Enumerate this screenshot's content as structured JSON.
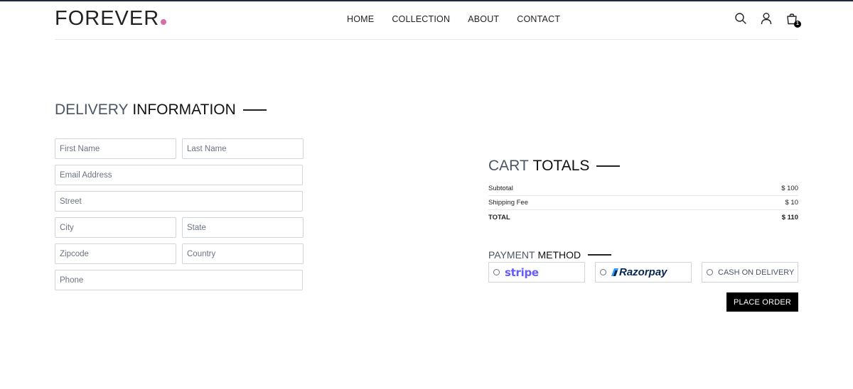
{
  "brand": {
    "name": "FOREVER",
    "dot_color": "#d66ca8"
  },
  "nav": {
    "items": [
      "HOME",
      "COLLECTION",
      "ABOUT",
      "CONTACT"
    ]
  },
  "header_icons": {
    "search": "search-icon",
    "profile": "user-icon",
    "cart": "shopping-bag-icon",
    "cart_count": "1"
  },
  "delivery": {
    "title_light": "DELIVERY",
    "title_dark": "INFORMATION",
    "fields": {
      "first_name": "First Name",
      "last_name": "Last Name",
      "email": "Email Address",
      "street": "Street",
      "city": "City",
      "state": "State",
      "zipcode": "Zipcode",
      "country": "Country",
      "phone": "Phone"
    }
  },
  "cart": {
    "title_light": "CART",
    "title_dark": "TOTALS",
    "rows": [
      {
        "label": "Subtotal",
        "value": "$ 100"
      },
      {
        "label": "Shipping Fee",
        "value": "$ 10"
      },
      {
        "label": "TOTAL",
        "value": "$ 110"
      }
    ]
  },
  "payment": {
    "title_light": "PAYMENT",
    "title_dark": "METHOD",
    "options": [
      "stripe",
      "Razorpay",
      "CASH ON DELIVERY"
    ],
    "colors": {
      "stripe": "#635bff",
      "razorpay": "#072654",
      "razorpay_mark": "#3395ff"
    }
  },
  "place_order": "PLACE ORDER"
}
